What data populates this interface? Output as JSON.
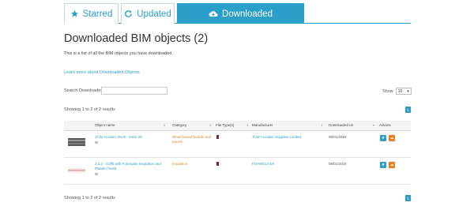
{
  "tabs": [
    {
      "label": "Starred",
      "icon": "star-icon"
    },
    {
      "label": "Updated",
      "icon": "refresh-icon"
    },
    {
      "label": "Downloaded",
      "icon": "cloud-download-icon",
      "active": true
    }
  ],
  "page": {
    "title": "Downloaded BIM objects (2)",
    "intro": "This is a list of all the BIM objects you have downloaded.",
    "learn_link": "Learn more about Downloaded Objects"
  },
  "search": {
    "label": "Search Downloaded:",
    "value": ""
  },
  "show": {
    "label": "Show",
    "value": "10"
  },
  "showing": "Showing 1 to 2 of 2 results",
  "pagination": {
    "current": "1"
  },
  "table": {
    "headers": [
      "Object name",
      "Category",
      "File Type(s)",
      "Manufacturer",
      "Downloaded on",
      "Actions"
    ],
    "rows": [
      {
        "name": "JCW Acoustic Deck - Deck 28",
        "category": "Wood based boards and panels",
        "manufacturer": "JCW Acoustic Supplies Limited",
        "downloaded": "06/01/2016"
      },
      {
        "name": "3.3.3 - Soffit with Foamglas Insulation and Plaster Finish",
        "category": "Insulation",
        "manufacturer": "FOAMGLAS®",
        "downloaded": "06/01/2016"
      }
    ]
  },
  "colors": {
    "accent": "#2a9fc9",
    "download": "#e67e22"
  }
}
